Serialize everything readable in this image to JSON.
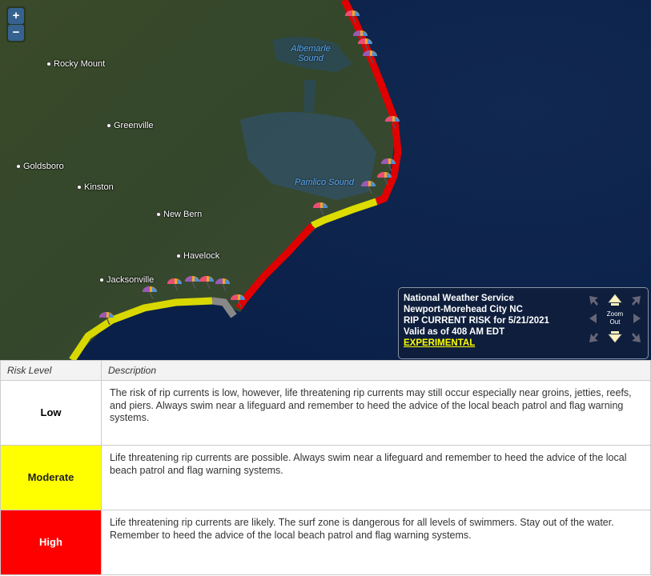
{
  "map": {
    "zoom_in_label": "+",
    "zoom_out_label": "−",
    "cities": [
      {
        "name": "Rocky Mount"
      },
      {
        "name": "Greenville"
      },
      {
        "name": "Goldsboro"
      },
      {
        "name": "Kinston"
      },
      {
        "name": "New Bern"
      },
      {
        "name": "Havelock"
      },
      {
        "name": "Jacksonville"
      }
    ],
    "water_labels": [
      {
        "name": "Albemarle\nSound"
      },
      {
        "name": "Pamlico Sound"
      }
    ],
    "risk_colors": {
      "low": "#ffffff",
      "moderate": "#ffff00",
      "high": "#ff0000",
      "none": "#808080"
    }
  },
  "legend_box": {
    "line1": "National Weather Service",
    "line2": "Newport-Morehead City NC",
    "line3": "RIP CURRENT RISK for 5/21/2021",
    "line4": "Valid as of 408 AM EDT",
    "experimental": "EXPERIMENTAL",
    "zoom_out_label": "Zoom Out"
  },
  "table": {
    "headers": [
      "Risk Level",
      "Description"
    ],
    "rows": [
      {
        "level": "Low",
        "color": "#ffffff",
        "description": "The risk of rip currents is low, however, life threatening rip currents may still occur especially near groins, jetties, reefs, and piers. Always swim near a lifeguard and remember to heed the advice of the local beach patrol and flag warning systems."
      },
      {
        "level": "Moderate",
        "color": "#ffff00",
        "description": "Life threatening rip currents are possible. Always swim near a lifeguard and remember to heed the advice of the local beach patrol and flag warning systems."
      },
      {
        "level": "High",
        "color": "#ff0000",
        "description": "Life threatening rip currents are likely. The surf zone is dangerous for all levels of swimmers. Stay out of the water. Remember to heed the advice of the local beach patrol and flag warning systems."
      }
    ]
  }
}
